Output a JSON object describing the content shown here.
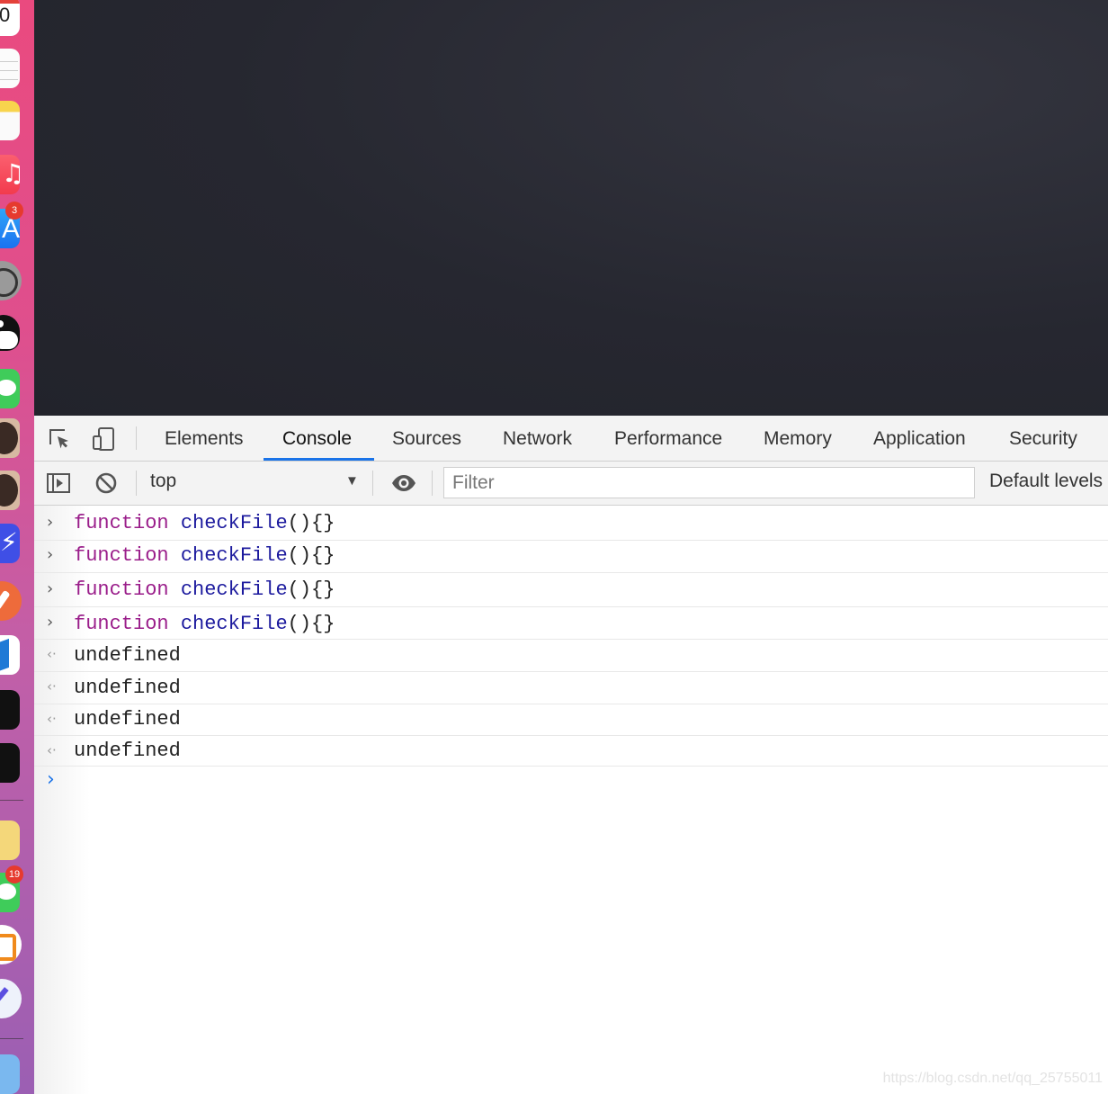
{
  "dock": {
    "badges": [
      "3",
      "19"
    ]
  },
  "devtools": {
    "tabs": [
      "Elements",
      "Console",
      "Sources",
      "Network",
      "Performance",
      "Memory",
      "Application",
      "Security"
    ],
    "active_tab": "Console",
    "toolbar": {
      "context": "top",
      "filter_placeholder": "Filter",
      "levels": "Default levels"
    },
    "console": {
      "inputs": [
        {
          "keyword": "function",
          "name": "checkFile",
          "rest": "(){}"
        },
        {
          "keyword": "function",
          "name": "checkFile",
          "rest": "(){}"
        },
        {
          "keyword": "function",
          "name": "checkFile",
          "rest": "(){}"
        },
        {
          "keyword": "function",
          "name": "checkFile",
          "rest": "(){}"
        }
      ],
      "outputs": [
        "undefined",
        "undefined",
        "undefined",
        "undefined"
      ]
    },
    "colors": {
      "accent": "#1a73e8",
      "keyword": "#9a1d8a",
      "function_name": "#1c1a9e"
    }
  },
  "watermark": "https://blog.csdn.net/qq_25755011"
}
